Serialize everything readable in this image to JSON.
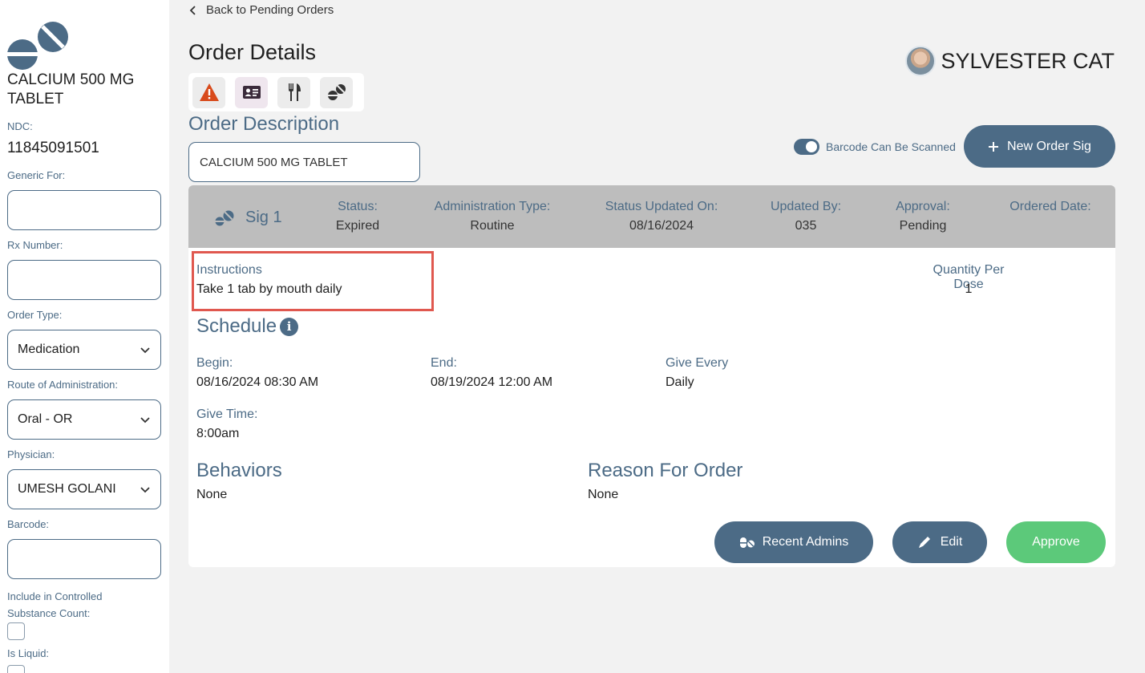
{
  "sidebar": {
    "drug_name": "CALCIUM 500 MG TABLET",
    "ndc_label": "NDC:",
    "ndc_value": "11845091501",
    "generic_for_label": "Generic For:",
    "generic_for_value": "",
    "rx_number_label": "Rx Number:",
    "rx_number_value": "",
    "order_type_label": "Order Type:",
    "order_type_value": "Medication",
    "route_label": "Route of Administration:",
    "route_value": "Oral - OR",
    "physician_label": "Physician:",
    "physician_value": "UMESH GOLANI",
    "barcode_label": "Barcode:",
    "barcode_value": "",
    "controlled_label": "Include in Controlled Substance Count:",
    "controlled_checked": false,
    "liquid_label": "Is Liquid:",
    "liquid_checked": false
  },
  "header": {
    "back_link": "Back to Pending Orders",
    "title": "Order Details",
    "patient_name": "SYLVESTER CAT",
    "icons": [
      "warning-icon",
      "id-card-icon",
      "fork-knife-icon",
      "pills-icon"
    ]
  },
  "order": {
    "description_label": "Order Description",
    "description_value": "CALCIUM 500 MG TABLET",
    "barcode_toggle_label": "Barcode Can Be Scanned",
    "barcode_toggle_on": true,
    "new_sig_label": "New Order Sig"
  },
  "sig": {
    "title": "Sig 1",
    "status_label": "Status:",
    "status_value": "Expired",
    "admin_type_label": "Administration Type:",
    "admin_type_value": "Routine",
    "status_updated_label": "Status Updated On:",
    "status_updated_value": "08/16/2024",
    "updated_by_label": "Updated By:",
    "updated_by_value": "035",
    "approval_label": "Approval:",
    "approval_value": "Pending",
    "ordered_date_label": "Ordered Date:",
    "ordered_date_value": "",
    "instructions_label": "Instructions",
    "instructions_value": "Take 1 tab by mouth daily",
    "qty_label": "Quantity Per Dose",
    "qty_value": "1",
    "schedule_heading": "Schedule",
    "begin_label": "Begin:",
    "begin_value": "08/16/2024 08:30 AM",
    "end_label": "End:",
    "end_value": "08/19/2024 12:00 AM",
    "give_every_label": "Give Every",
    "give_every_value": "Daily",
    "give_time_label": "Give Time:",
    "give_time_value": "8:00am",
    "behaviors_heading": "Behaviors",
    "behaviors_value": "None",
    "reason_heading": "Reason For Order",
    "reason_value": "None",
    "recent_admins_label": "Recent Admins",
    "edit_label": "Edit",
    "approve_label": "Approve"
  },
  "colors": {
    "accent": "#4c6b86",
    "approve": "#5cc97a",
    "highlight": "#e0584f",
    "warning": "#d84a1b"
  }
}
